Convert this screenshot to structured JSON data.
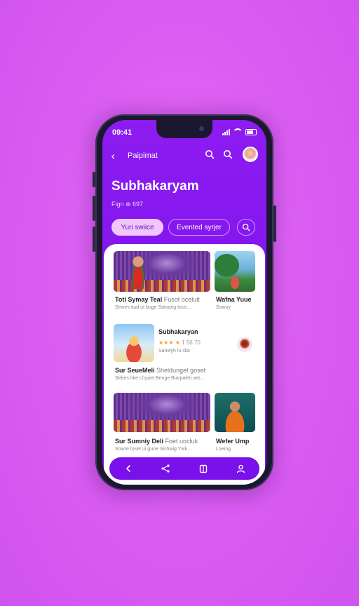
{
  "status": {
    "time": "09:41"
  },
  "header": {
    "app_name": "Paipimat",
    "title": "Subhakaryam",
    "subtitle": "Fign ⊕ 697"
  },
  "chips": [
    {
      "label": "Yuri swiice"
    },
    {
      "label": "Evented syrjer"
    }
  ],
  "cards": [
    {
      "title": "Toti Symay Teal",
      "title_light": "Fusot oceluit",
      "desc": "Sewes toal ut buge Satvarig toce..."
    },
    {
      "title": "Wafna Yuue",
      "title_light": "",
      "desc": "Sowuy"
    },
    {
      "title": "Subhakaryan",
      "rating": "★★★ ★",
      "meta": "1 56.70",
      "desc": "Sanwyh lu slia"
    },
    {
      "title": "Sur SeueMeli",
      "title_light": "Sheldunget goset",
      "desc": "Sebes hke Lhyaet Benge Biarpaleti aet..."
    },
    {
      "title": "Sur Sumniy Deli",
      "title_light": "Foet uocluk",
      "desc": "Sowre toset ui gune Sishwig Ywk..."
    },
    {
      "title": "Wefer Ump",
      "title_light": "",
      "desc": "Loeing"
    }
  ],
  "icons": {
    "back": "chevron-left-icon",
    "search": "search-icon",
    "nav": [
      "back-icon",
      "share-icon",
      "bookmark-icon",
      "profile-icon"
    ]
  },
  "colors": {
    "background": "#d95cf2",
    "primary": "#8215ee",
    "chip_active": "#f0c6fb",
    "star": "#f3a21a"
  }
}
